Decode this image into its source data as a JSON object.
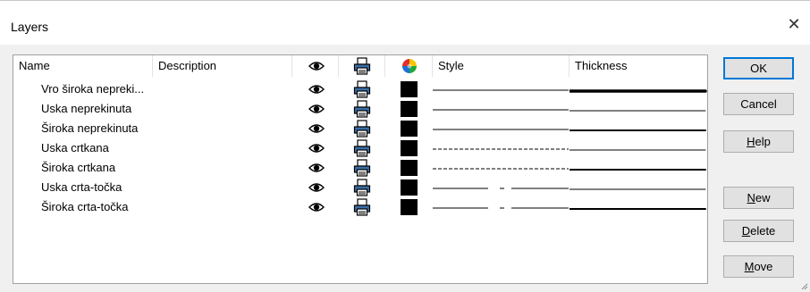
{
  "window": {
    "title": "Layers",
    "close_glyph": "✕"
  },
  "columns": {
    "name": "Name",
    "description": "Description",
    "visible_icon": "eye-icon",
    "print_icon": "printer-icon",
    "color_icon": "color-wheel-icon",
    "style": "Style",
    "thickness": "Thickness"
  },
  "layers": [
    {
      "name": "Vro široka nepreki...",
      "description": "",
      "visible": true,
      "printable": true,
      "color": "#000000",
      "style": "solid",
      "thickness": "thick"
    },
    {
      "name": "Uska neprekinuta",
      "description": "",
      "visible": true,
      "printable": true,
      "color": "#000000",
      "style": "solid",
      "thickness": "thin"
    },
    {
      "name": "Široka neprekinuta",
      "description": "",
      "visible": true,
      "printable": true,
      "color": "#000000",
      "style": "solid",
      "thickness": "medium"
    },
    {
      "name": "Uska crtkana",
      "description": "",
      "visible": true,
      "printable": true,
      "color": "#000000",
      "style": "dashed",
      "thickness": "thin"
    },
    {
      "name": "Široka crtkana",
      "description": "",
      "visible": true,
      "printable": true,
      "color": "#000000",
      "style": "dashed",
      "thickness": "medium"
    },
    {
      "name": "Uska crta-točka",
      "description": "",
      "visible": true,
      "printable": true,
      "color": "#000000",
      "style": "dash-dot",
      "thickness": "thin"
    },
    {
      "name": "Široka crta-točka",
      "description": "",
      "visible": true,
      "printable": true,
      "color": "#000000",
      "style": "dash-dot",
      "thickness": "medium"
    }
  ],
  "buttons": {
    "ok": "OK",
    "cancel": "Cancel",
    "help": "Help",
    "new": "New",
    "delete": "Delete",
    "move": "Move"
  }
}
